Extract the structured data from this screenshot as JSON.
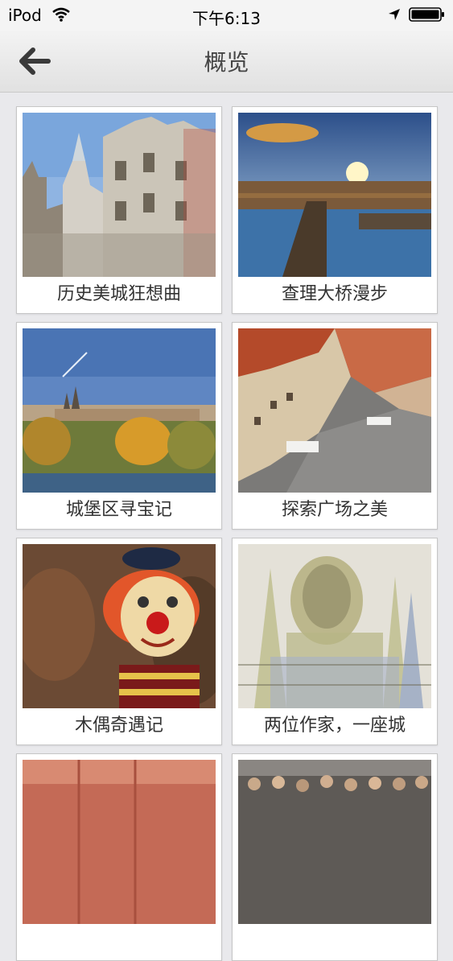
{
  "status_bar": {
    "carrier": "iPod",
    "time": "下午6:13",
    "icons": [
      "wifi-icon",
      "location-arrow-icon",
      "battery-icon"
    ]
  },
  "nav": {
    "title": "概览",
    "back_icon": "back-arrow-icon"
  },
  "cards": [
    {
      "title": "历史美城狂想曲",
      "image": "prague-old-town-towers-photo"
    },
    {
      "title": "查理大桥漫步",
      "image": "charles-bridge-sunset-photo"
    },
    {
      "title": "城堡区寻宝记",
      "image": "prague-castle-autumn-photo"
    },
    {
      "title": "探索广场之美",
      "image": "old-town-square-aerial-photo"
    },
    {
      "title": "木偶奇遇记",
      "image": "clown-marionette-photo"
    },
    {
      "title": "两位作家，一座城",
      "image": "kafka-city-mural-photo"
    },
    {
      "title": "",
      "image": "red-painted-wall-photo"
    },
    {
      "title": "",
      "image": "crowd-in-square-photo"
    }
  ]
}
